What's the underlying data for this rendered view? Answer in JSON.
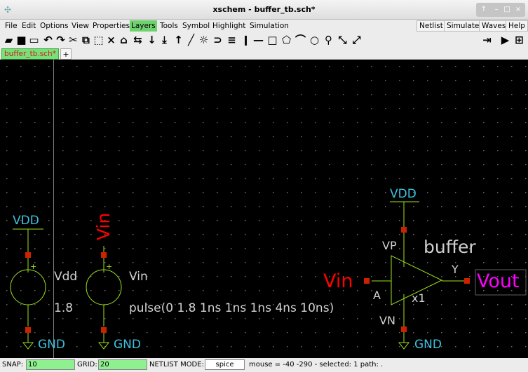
{
  "window": {
    "title": "xschem - buffer_tb.sch*",
    "buttons": [
      "↑",
      "–",
      "□",
      "×"
    ]
  },
  "menu": {
    "items": [
      "File",
      "Edit",
      "Options",
      "View",
      "Properties",
      "Layers",
      "Tools",
      "Symbol",
      "Highlight",
      "Simulation"
    ],
    "active": "Layers",
    "right": [
      "Netlist",
      "Simulate",
      "Waves",
      "Help"
    ]
  },
  "toolbar": {
    "left": [
      "open-icon",
      "save-icon",
      "reload-icon",
      "undo-icon",
      "redo-icon",
      "cut-icon",
      "copy-icon",
      "paste-icon",
      "delete-icon",
      "place-symbol-icon",
      "wire-bus-icon",
      "push-icon",
      "descend-icon",
      "pop-icon",
      "line-icon",
      "highlight-icon",
      "gate-icon",
      "netlist-text-icon",
      "pin-icon",
      "bus-line-icon",
      "rectangle-icon",
      "polygon-icon",
      "arc-icon",
      "circle-icon",
      "zoom-icon",
      "zoom-in-icon",
      "zoom-out-icon"
    ],
    "right": [
      "netlist-go-icon",
      "simulate-icon",
      "waves-icon"
    ]
  },
  "tabs": {
    "current": "buffer_tb.sch*",
    "add": "+"
  },
  "schematic": {
    "vdd_source": {
      "net_top": "VDD",
      "name": "Vdd",
      "value": "1.8",
      "net_bottom": "GND"
    },
    "vin_source": {
      "net_top": "Vin",
      "name": "Vin",
      "value": "pulse(0 1.8 1ns 1ns 1ns 4ns 10ns)",
      "net_bottom": "GND"
    },
    "buffer": {
      "symbol": "buffer",
      "instance": "x1",
      "pin_vp": "VP",
      "pin_vn": "VN",
      "pin_a": "A",
      "pin_y": "Y",
      "net_top": "VDD",
      "net_bottom": "GND",
      "net_in": "Vin",
      "net_out": "Vout"
    },
    "colors": {
      "wire": "#a0e020",
      "pin": "#cc2200",
      "net_label": "#40c0e0",
      "vin_label": "#ff0000",
      "vout_label": "#ff00ff",
      "text": "#d0d0d0",
      "grid": "#6a6a6a"
    }
  },
  "status": {
    "snap_label": "SNAP:",
    "snap_value": "10",
    "grid_label": "GRID:",
    "grid_value": "20",
    "netlist_mode_label": "NETLIST MODE:",
    "netlist_mode_value": "spice",
    "info": "mouse = -40 -290 - selected: 1 path: ."
  }
}
